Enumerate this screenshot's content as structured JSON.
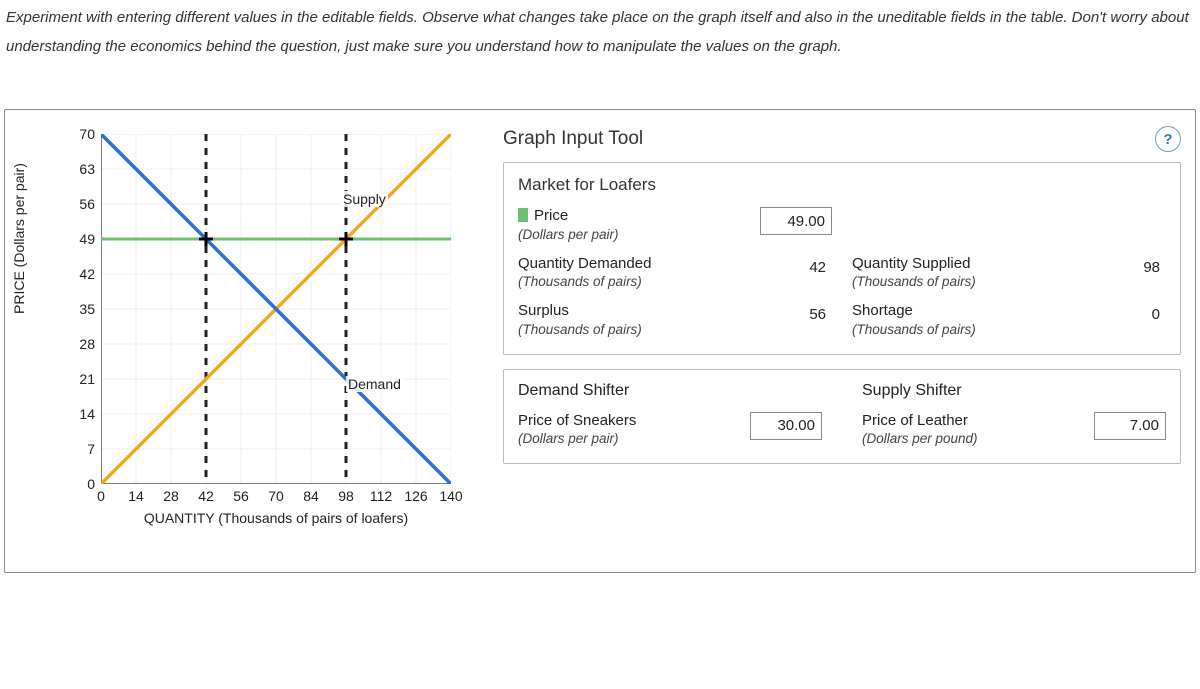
{
  "instructions": "Experiment with entering different values in the editable fields. Observe what changes take place on the graph itself and also in the uneditable fields in the table. Don't worry about understanding the economics behind the question, just make sure you understand how to manipulate the values on the graph.",
  "tool_title": "Graph Input Tool",
  "help_icon": "?",
  "market": {
    "title": "Market for Loafers",
    "price": {
      "label": "Price",
      "sub": "(Dollars per pair)",
      "value": "49.00"
    },
    "qd": {
      "label": "Quantity Demanded",
      "sub": "(Thousands of pairs)",
      "value": "42"
    },
    "qs": {
      "label": "Quantity Supplied",
      "sub": "(Thousands of pairs)",
      "value": "98"
    },
    "surplus": {
      "label": "Surplus",
      "sub": "(Thousands of pairs)",
      "value": "56"
    },
    "shortage": {
      "label": "Shortage",
      "sub": "(Thousands of pairs)",
      "value": "0"
    }
  },
  "shifters": {
    "demand": {
      "title": "Demand Shifter",
      "field": {
        "label": "Price of Sneakers",
        "sub": "(Dollars per pair)",
        "value": "30.00"
      }
    },
    "supply": {
      "title": "Supply Shifter",
      "field": {
        "label": "Price of Leather",
        "sub": "(Dollars per pound)",
        "value": "7.00"
      }
    }
  },
  "chart_data": {
    "type": "line",
    "title": "",
    "xlabel": "QUANTITY (Thousands of pairs of loafers)",
    "ylabel": "PRICE (Dollars per pair)",
    "xlim": [
      0,
      140
    ],
    "ylim": [
      0,
      70
    ],
    "x_ticks": [
      0,
      14,
      28,
      42,
      56,
      70,
      84,
      98,
      112,
      126,
      140
    ],
    "y_ticks": [
      0,
      7,
      14,
      21,
      28,
      35,
      42,
      49,
      56,
      63,
      70
    ],
    "series": [
      {
        "name": "Supply",
        "color": "#f5a623",
        "x": [
          0,
          140
        ],
        "y": [
          0,
          70
        ]
      },
      {
        "name": "Demand",
        "color": "#2e6fd6",
        "x": [
          0,
          140
        ],
        "y": [
          70,
          0
        ]
      }
    ],
    "price_line": {
      "y": 49,
      "color": "#6cc070"
    },
    "vlines": [
      {
        "x": 42,
        "color": "#222"
      },
      {
        "x": 98,
        "color": "#222"
      }
    ],
    "markers": [
      {
        "x": 42,
        "y": 49
      },
      {
        "x": 98,
        "y": 49
      }
    ],
    "series_labels": {
      "Supply": {
        "x": 96,
        "y": 57
      },
      "Demand": {
        "x": 98,
        "y": 20
      }
    }
  }
}
